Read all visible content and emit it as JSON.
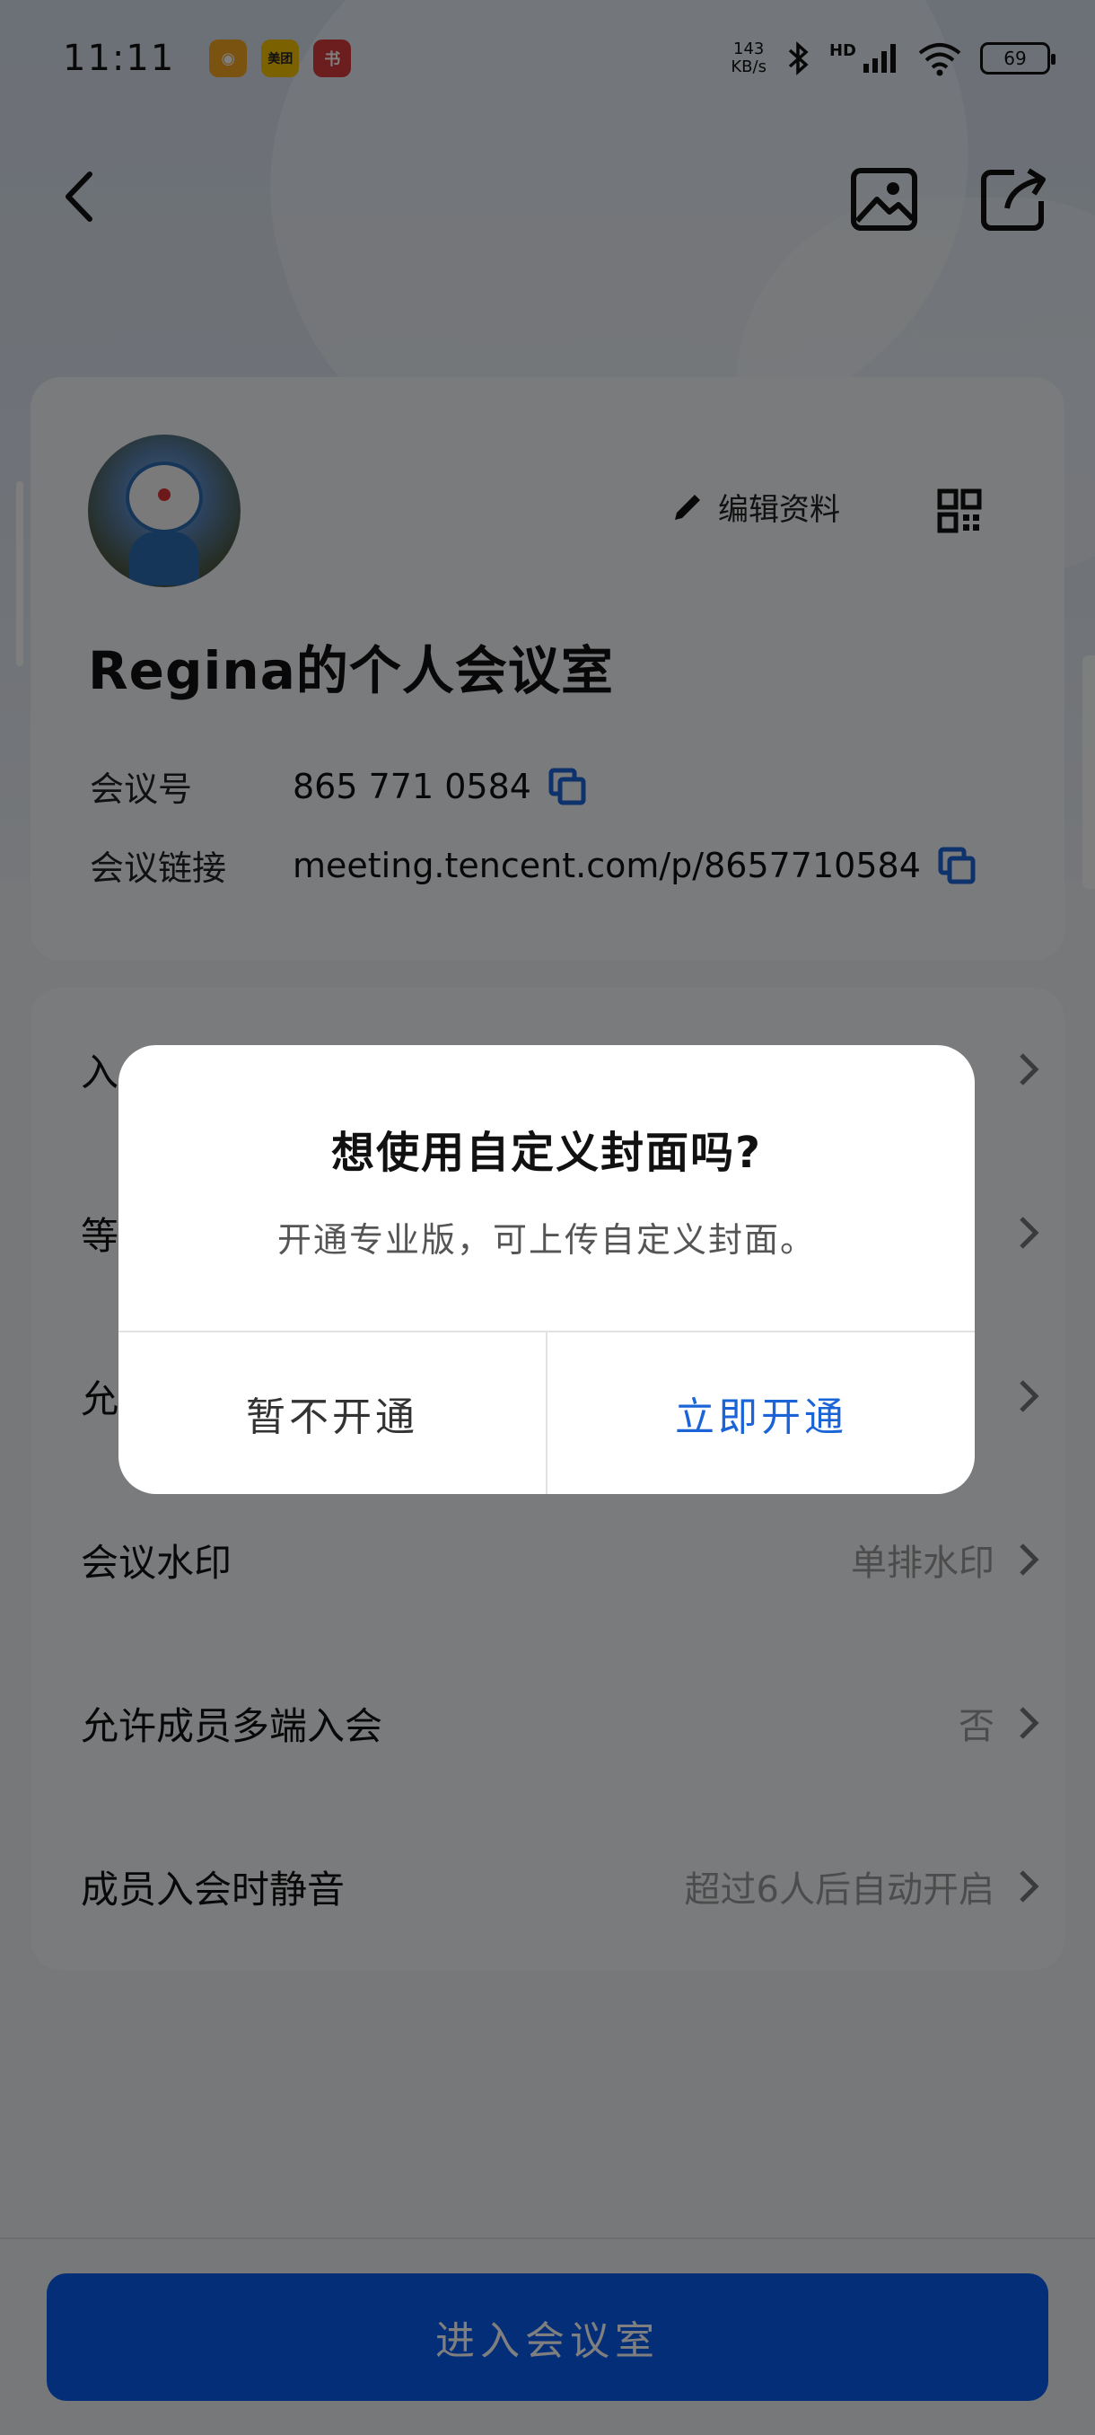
{
  "status_bar": {
    "time": "11:11",
    "apps": [
      {
        "name": "weibo-icon",
        "color": "#f5a623",
        "glyph": "◉"
      },
      {
        "name": "meituan-icon",
        "color": "#f7c200",
        "glyph": "美团"
      },
      {
        "name": "xiaohongshu-icon",
        "color": "#d93a3a",
        "glyph": "书"
      }
    ],
    "net_speed_value": "143",
    "net_speed_unit": "KB/s",
    "network_type": "HD",
    "battery": "69"
  },
  "profile": {
    "edit_label": "编辑资料",
    "room_title": "Regina的个人会议室",
    "meeting_id_label": "会议号",
    "meeting_id_value": "865 771 0584",
    "meeting_link_label": "会议链接",
    "meeting_link_value": "meeting.tencent.com/p/8657710584"
  },
  "settings": [
    {
      "label": "入",
      "value": ""
    },
    {
      "label": "等",
      "value": ""
    },
    {
      "label": "允",
      "value": ""
    },
    {
      "label": "会议水印",
      "value": "单排水印"
    },
    {
      "label": "允许成员多端入会",
      "value": "否"
    },
    {
      "label": "成员入会时静音",
      "value": "超过6人后自动开启"
    }
  ],
  "enter_button": "进入会议室",
  "dialog": {
    "title": "想使用自定义封面吗?",
    "message": "开通专业版，可上传自定义封面。",
    "cancel": "暂不开通",
    "confirm": "立即开通"
  },
  "colors": {
    "accent": "#1a64d8",
    "primary_button": "#0a5cf0"
  }
}
